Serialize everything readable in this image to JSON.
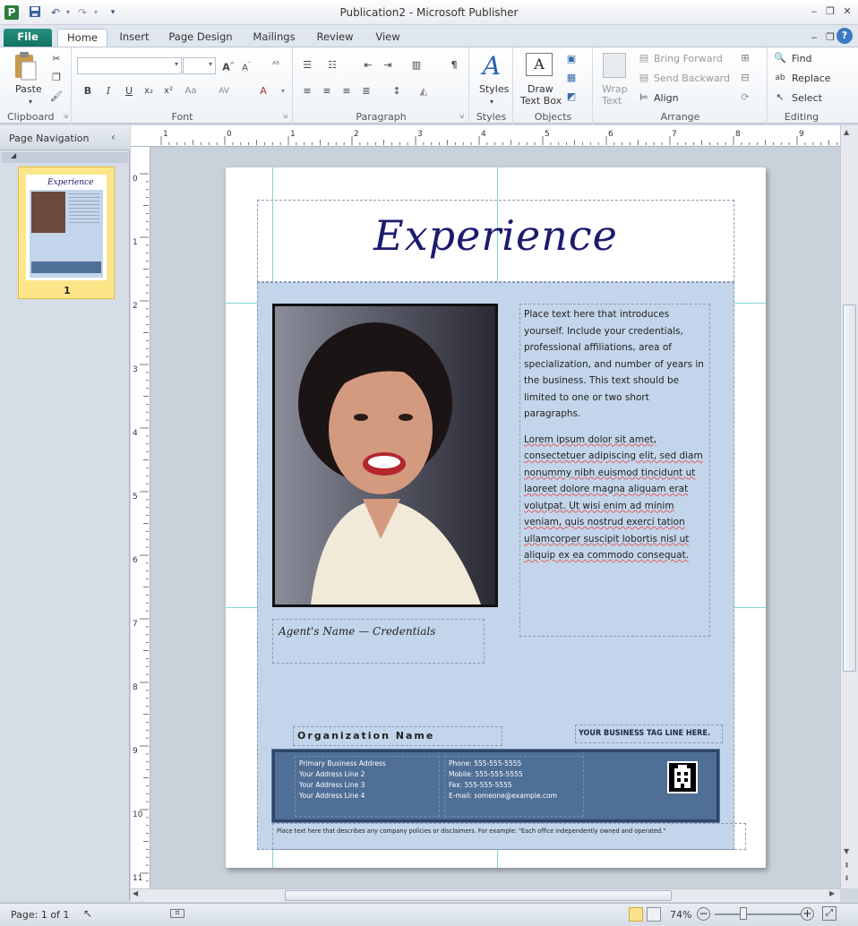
{
  "window": {
    "title": "Publication2 - Microsoft Publisher",
    "app_icon": "P",
    "controls": {
      "minimize": "‒",
      "restore": "❐",
      "close": "✕",
      "ribbon_min": "‒",
      "ribbon_restore": "❐",
      "ribbon_close": "✕",
      "help": "?"
    }
  },
  "tabs": [
    "File",
    "Home",
    "Insert",
    "Page Design",
    "Mailings",
    "Review",
    "View"
  ],
  "ribbon": {
    "clipboard": {
      "label": "Clipboard",
      "paste": "Paste"
    },
    "font": {
      "label": "Font"
    },
    "paragraph": {
      "label": "Paragraph"
    },
    "styles": {
      "label": "Styles",
      "styles_button": "Styles"
    },
    "objects": {
      "label": "Objects",
      "draw_text_box_1": "Draw",
      "draw_text_box_2": "Text Box"
    },
    "arrange": {
      "label": "Arrange",
      "wrap_1": "Wrap",
      "wrap_2": "Text",
      "bring_forward": "Bring Forward",
      "send_backward": "Send Backward",
      "align": "Align"
    },
    "editing": {
      "label": "Editing",
      "find": "Find",
      "replace": "Replace",
      "select": "Select"
    }
  },
  "nav": {
    "title": "Page Navigation",
    "page_number": "1"
  },
  "ruler_top": [
    "1",
    "0",
    "1",
    "2",
    "3",
    "4",
    "5",
    "6",
    "7",
    "8",
    "9"
  ],
  "ruler_left": [
    "0",
    "1",
    "2",
    "3",
    "4",
    "5",
    "6",
    "7",
    "8",
    "9",
    "10",
    "11"
  ],
  "publication": {
    "heading": "Experience",
    "intro": "Place text here that introduces yourself. Include your credentials, professional affiliations, area of specialization, and number of years in the business. This text should be limited to one or two short paragraphs.",
    "lorem": "Lorem ipsum dolor sit amet, consectetuer adipiscing elit, sed diam nonummy nibh euismod tincidunt ut laoreet dolore magna aliquam erat volutpat. Ut wisi enim ad minim veniam, quis nostrud exerci tation ullamcorper suscipit lobortis nisl ut aliquip ex ea commodo consequat.",
    "agent_caption": "Agent's Name — Credentials",
    "org_name": "Organization Name",
    "tagline": "YOUR BUSINESS TAG LINE HERE.",
    "address": [
      "Primary Business Address",
      "Your Address Line 2",
      "Your Address Line 3",
      "Your Address Line 4"
    ],
    "contacts": [
      "Phone: 555-555-5555",
      "Mobile: 555-555-5555",
      "Fax: 555-555-5555",
      "E-mail: someone@example.com"
    ],
    "disclaimer": "Place text here that describes any company policies or disclaimers. For example: \"Each office independently owned and operated.\""
  },
  "status": {
    "page": "Page: 1 of 1",
    "zoom": "74%"
  },
  "colors": {
    "accent": "#0f7263",
    "panel": "#c3d5ea",
    "footer": "#4f6f96",
    "heading": "#1c1a6e"
  }
}
